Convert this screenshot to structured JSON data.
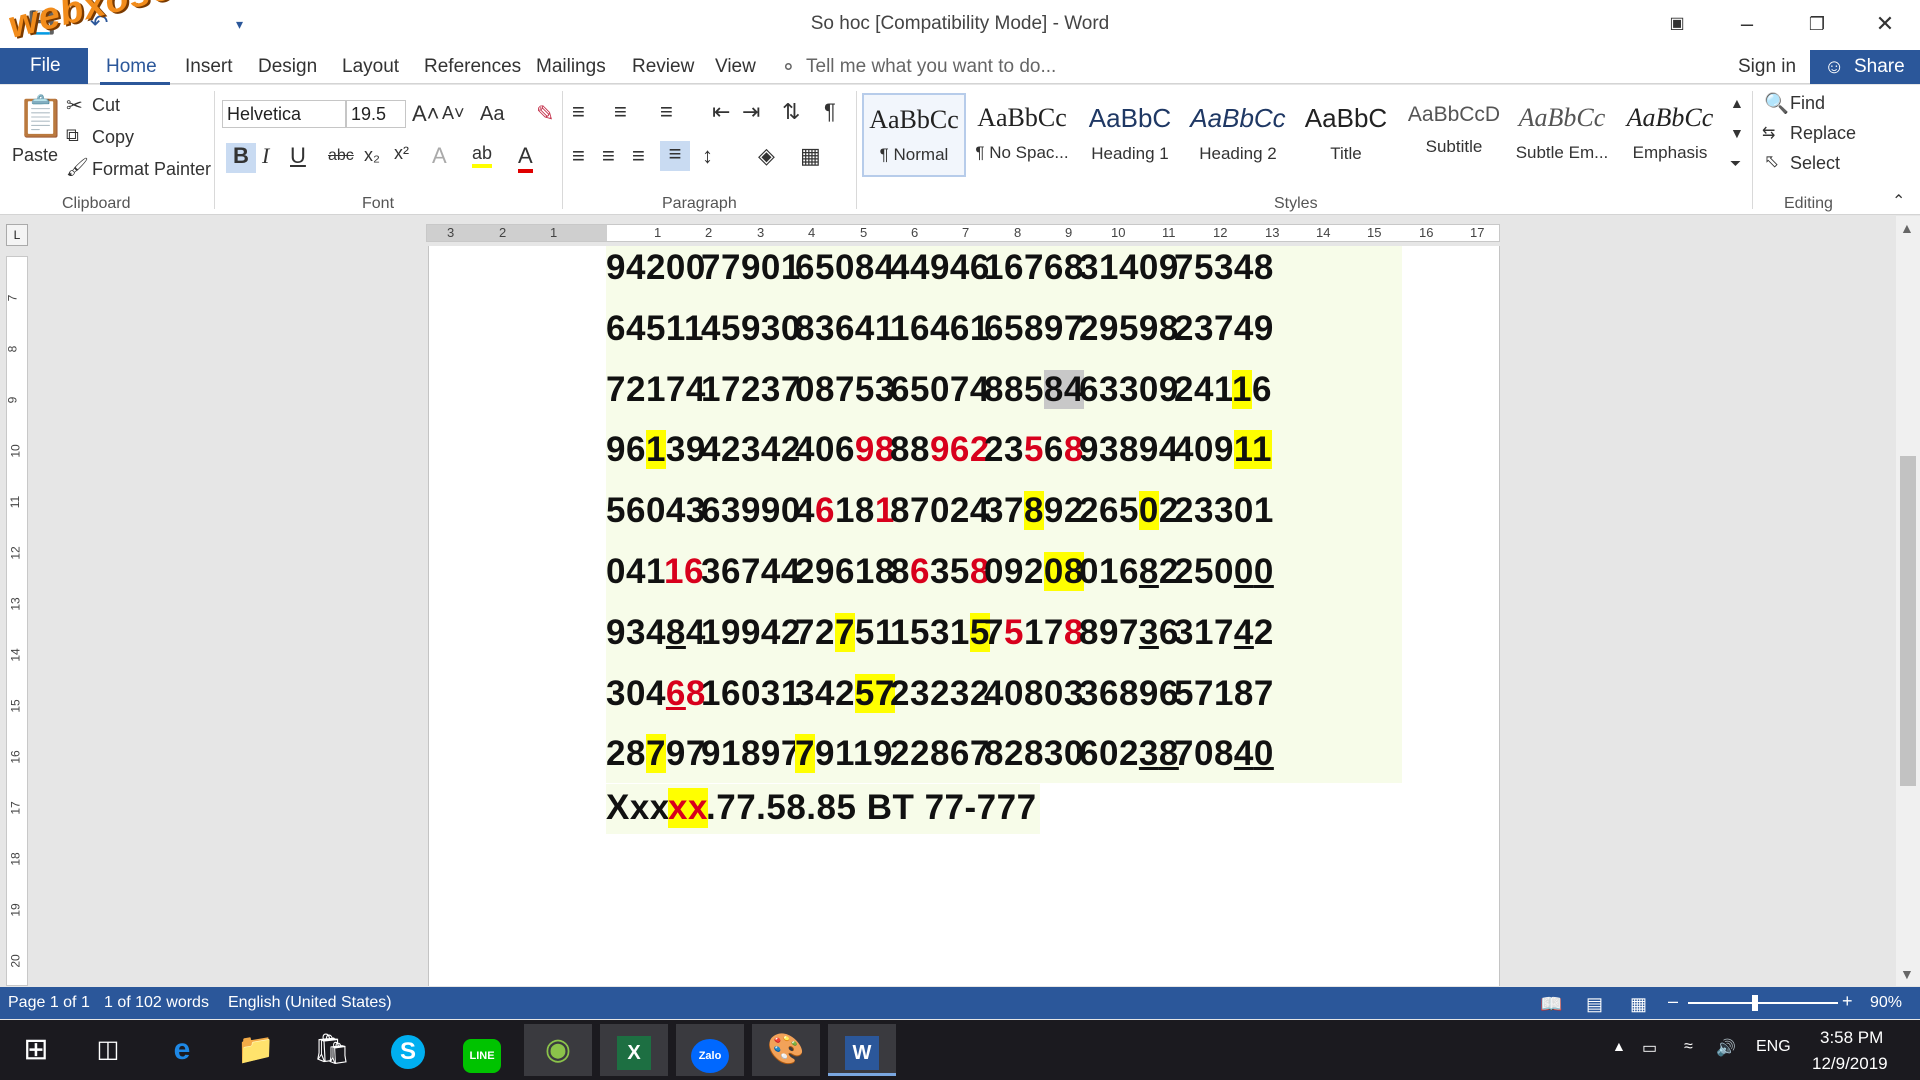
{
  "window": {
    "title": "So hoc [Compatibility Mode] - Word",
    "watermark": "webxoso.net"
  },
  "tabs": {
    "file": "File",
    "items": [
      "Home",
      "Insert",
      "Design",
      "Layout",
      "References",
      "Mailings",
      "Review",
      "View"
    ],
    "tell_me": "Tell me what you want to do...",
    "sign_in": "Sign in",
    "share": "Share"
  },
  "ribbon": {
    "clipboard": {
      "label": "Clipboard",
      "paste": "Paste",
      "cut": "Cut",
      "copy": "Copy",
      "format_painter": "Format Painter"
    },
    "font": {
      "label": "Font",
      "name": "Helvetica",
      "size": "19.5",
      "aa": "Aa"
    },
    "paragraph": {
      "label": "Paragraph"
    },
    "styles": {
      "label": "Styles",
      "items": [
        {
          "sample": "AaBbCc",
          "name": "¶ Normal"
        },
        {
          "sample": "AaBbCc",
          "name": "¶ No Spac..."
        },
        {
          "sample": "AaBbC",
          "name": "Heading 1"
        },
        {
          "sample": "AaBbCc",
          "name": "Heading 2"
        },
        {
          "sample": "AaBbC",
          "name": "Title"
        },
        {
          "sample": "AaBbCcD",
          "name": "Subtitle"
        },
        {
          "sample": "AaBbCc",
          "name": "Subtle Em..."
        },
        {
          "sample": "AaBbCc",
          "name": "Emphasis"
        }
      ]
    },
    "editing": {
      "label": "Editing",
      "find": "Find",
      "replace": "Replace",
      "select": "Select"
    }
  },
  "ruler": {
    "ticks": [
      "3",
      "2",
      "1",
      "1",
      "2",
      "3",
      "4",
      "5",
      "6",
      "7",
      "8",
      "9",
      "10",
      "11",
      "12",
      "13",
      "14",
      "15",
      "16",
      "17"
    ],
    "vticks": [
      "7",
      "8",
      "9",
      "10",
      "11",
      "12",
      "13",
      "14",
      "15",
      "16",
      "17",
      "18",
      "19",
      "20"
    ]
  },
  "document": {
    "rows": [
      [
        "94200",
        "77901",
        "65084",
        "44946",
        "16768",
        "31409",
        "75348"
      ],
      [
        "64511",
        "45930",
        "83641",
        "16461",
        "65897",
        "29598",
        "23749"
      ],
      [
        "72174",
        "17237",
        "08753",
        "65074",
        "88584",
        "63309",
        "24116"
      ],
      [
        "96139",
        "42342",
        "40698",
        "88962",
        "23568",
        "93894",
        "40911"
      ],
      [
        "56043",
        "63990",
        "46181",
        "87024",
        "37892",
        "26502",
        "23301"
      ],
      [
        "04116",
        "36744",
        "29618",
        "86358",
        "09208",
        "01682",
        "25000"
      ],
      [
        "93484",
        "19942",
        "72751",
        "15315",
        "75178",
        "89736",
        "31742"
      ],
      [
        "30468",
        "16031",
        "34257",
        "23232",
        "40803",
        "36896",
        "57187"
      ],
      [
        "28797",
        "91897",
        "79119",
        "22867",
        "82830",
        "60238",
        "70840"
      ]
    ],
    "last_line_prefix": "Xxx",
    "last_line_hl": "xx",
    "last_line_rest": " .77.58.85 BT 77-777"
  },
  "status": {
    "page": "Page 1 of 1",
    "words": "1 of 102 words",
    "language": "English (United States)",
    "zoom": "90%"
  },
  "taskbar": {
    "lang": "ENG",
    "time": "3:58 PM",
    "date": "12/9/2019"
  }
}
